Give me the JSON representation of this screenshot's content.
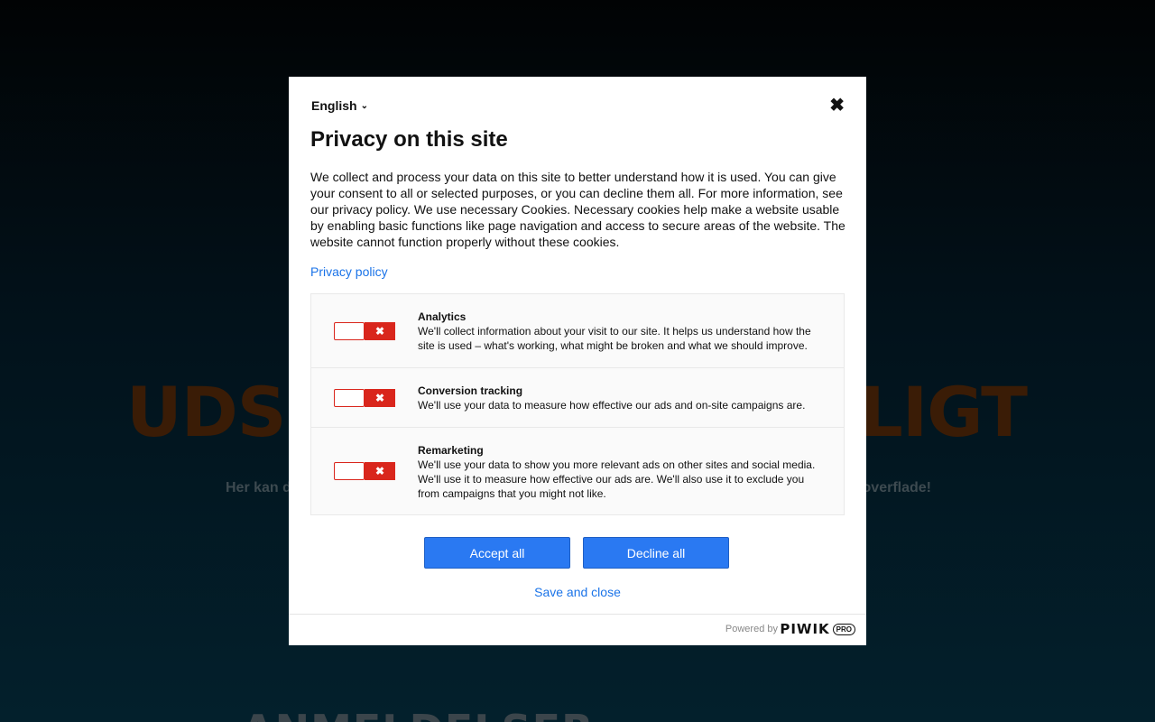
{
  "background": {
    "hero_left": "UDSI",
    "hero_right": "RLIGT",
    "sub_left": "Her kan d",
    "sub_right": "overflade!",
    "bottom_heading": "ANMELDELSER"
  },
  "modal": {
    "language": "English",
    "close_icon": "close-icon",
    "title": "Privacy on this site",
    "description": "We collect and process your data on this site to better understand how it is used. You can give your consent to all or selected purposes, or you can decline them all. For more information, see our privacy policy. We use necessary Cookies. Necessary cookies help make a website usable by enabling basic functions like page navigation and access to secure areas of the website. The website cannot function properly without these cookies.",
    "privacy_link": "Privacy policy",
    "categories": [
      {
        "name": "Analytics",
        "description": "We'll collect information about your visit to our site. It helps us understand how the site is used – what's working, what might be broken and what we should improve.",
        "enabled": false
      },
      {
        "name": "Conversion tracking",
        "description": "We'll use your data to measure how effective our ads and on-site campaigns are.",
        "enabled": false
      },
      {
        "name": "Remarketing",
        "description": "We'll use your data to show you more relevant ads on other sites and social media. We'll use it to measure how effective our ads are. We'll also use it to exclude you from campaigns that you might not like.",
        "enabled": false
      }
    ],
    "accept_all": "Accept all",
    "decline_all": "Decline all",
    "save_close": "Save and close",
    "powered_by": "Powered by",
    "brand": "PIWIK",
    "brand_badge": "PRO"
  },
  "colors": {
    "primary": "#2a79f2",
    "link": "#1a73e8",
    "toggle_off": "#d9261c"
  }
}
